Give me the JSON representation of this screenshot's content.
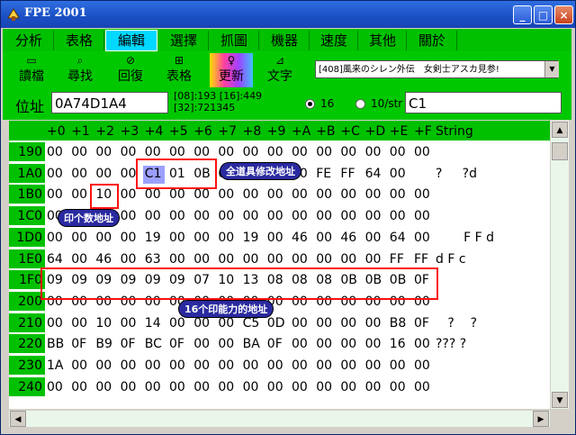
{
  "window": {
    "title": "FPE 2001",
    "btn_min": "_",
    "btn_max": "□",
    "btn_close": "×"
  },
  "menu": {
    "tabs": [
      {
        "label": "分析"
      },
      {
        "label": "表格"
      },
      {
        "label": "編輯",
        "active": true
      },
      {
        "label": "選擇"
      },
      {
        "label": "抓圖"
      },
      {
        "label": "機器"
      },
      {
        "label": "速度"
      },
      {
        "label": "其他"
      },
      {
        "label": "關於"
      }
    ]
  },
  "toolbar": {
    "items": [
      {
        "label": "讀檔",
        "icon": "open-icon"
      },
      {
        "label": "尋找",
        "icon": "search-icon"
      },
      {
        "label": "回復",
        "icon": "undo-icon"
      },
      {
        "label": "表格",
        "icon": "table-icon"
      },
      {
        "label": "更新",
        "icon": "refresh-icon"
      },
      {
        "label": "文字",
        "icon": "text-icon"
      }
    ]
  },
  "game_select": {
    "value": "[408]風来のシレン外伝　女剣士アスカ見参!"
  },
  "address": {
    "label": "位址",
    "value": "0A74D1A4",
    "info1": "[08]:193 [16]:449",
    "info2": "[32]:721345"
  },
  "mode": {
    "opt16": "16",
    "optstr": "10/str",
    "value": "C1"
  },
  "grid": {
    "cols": [
      "+0",
      "+1",
      "+2",
      "+3",
      "+4",
      "+5",
      "+6",
      "+7",
      "+8",
      "+9",
      "+A",
      "+B",
      "+C",
      "+D",
      "+E",
      "+F"
    ],
    "string_header": "String",
    "rows": [
      {
        "addr": "190",
        "cells": [
          "00",
          "00",
          "00",
          "00",
          "00",
          "00",
          "00",
          "00",
          "00",
          "00",
          "00",
          "00",
          "00",
          "00",
          "00",
          "00"
        ],
        "str": ""
      },
      {
        "addr": "1A0",
        "cells": [
          "00",
          "00",
          "00",
          "00",
          "C1",
          "01",
          "0B",
          "00",
          "00",
          "00",
          "00",
          "FE",
          "FF",
          "64",
          "00",
          ""
        ],
        "str": "?     ?d"
      },
      {
        "addr": "1B0",
        "cells": [
          "00",
          "00",
          "10",
          "00",
          "00",
          "00",
          "00",
          "00",
          "00",
          "00",
          "00",
          "00",
          "00",
          "00",
          "00",
          "00"
        ],
        "str": ""
      },
      {
        "addr": "1C0",
        "cells": [
          "00",
          "00",
          "00",
          "00",
          "00",
          "00",
          "00",
          "00",
          "00",
          "00",
          "00",
          "00",
          "00",
          "00",
          "00",
          "00"
        ],
        "str": ""
      },
      {
        "addr": "1D0",
        "cells": [
          "00",
          "00",
          "00",
          "00",
          "19",
          "00",
          "00",
          "00",
          "19",
          "00",
          "46",
          "00",
          "46",
          "00",
          "64",
          "00"
        ],
        "str": "       F F d"
      },
      {
        "addr": "1E0",
        "cells": [
          "64",
          "00",
          "46",
          "00",
          "63",
          "00",
          "00",
          "00",
          "00",
          "00",
          "00",
          "00",
          "00",
          "00",
          "FF",
          "FF"
        ],
        "str": "d F c"
      },
      {
        "addr": "1F0",
        "cells": [
          "09",
          "09",
          "09",
          "09",
          "09",
          "09",
          "07",
          "10",
          "13",
          "08",
          "08",
          "08",
          "0B",
          "0B",
          "0B",
          "0F"
        ],
        "str": ""
      },
      {
        "addr": "200",
        "cells": [
          "00",
          "00",
          "00",
          "00",
          "00",
          "00",
          "00",
          "00",
          "00",
          "00",
          "00",
          "00",
          "00",
          "00",
          "00",
          "00"
        ],
        "str": ""
      },
      {
        "addr": "210",
        "cells": [
          "00",
          "00",
          "10",
          "00",
          "14",
          "00",
          "00",
          "00",
          "C5",
          "0D",
          "00",
          "00",
          "00",
          "00",
          "B8",
          "0F"
        ],
        "str": "   ?    ?"
      },
      {
        "addr": "220",
        "cells": [
          "BB",
          "0F",
          "B9",
          "0F",
          "BC",
          "0F",
          "00",
          "00",
          "BA",
          "0F",
          "00",
          "00",
          "00",
          "00",
          "16",
          "00"
        ],
        "str": "??? ?"
      },
      {
        "addr": "230",
        "cells": [
          "1A",
          "00",
          "00",
          "00",
          "00",
          "00",
          "00",
          "00",
          "00",
          "00",
          "00",
          "00",
          "00",
          "00",
          "00",
          "00"
        ],
        "str": ""
      },
      {
        "addr": "240",
        "cells": [
          "00",
          "00",
          "00",
          "00",
          "00",
          "00",
          "00",
          "00",
          "00",
          "00",
          "00",
          "00",
          "00",
          "00",
          "00",
          "00"
        ],
        "str": ""
      }
    ]
  },
  "annotations": {
    "note_all": "全道具修改地址",
    "note_count": "印个数地址",
    "note_ability": "16个印能力的地址"
  }
}
